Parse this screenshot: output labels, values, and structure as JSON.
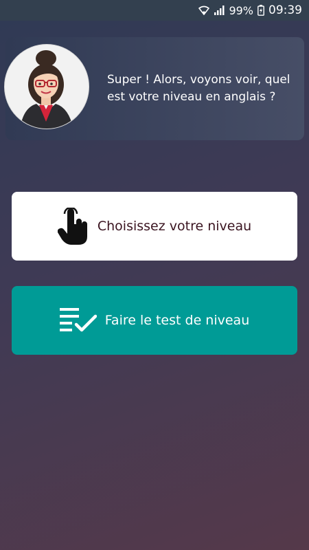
{
  "status_bar": {
    "battery": "99%",
    "time": "09:39",
    "icons": [
      "wifi-icon",
      "signal-icon",
      "battery-charging-icon"
    ]
  },
  "tutor": {
    "avatar_icon": "teacher-avatar",
    "message": "Super ! Alors, voyons voir, quel est votre niveau en anglais ?"
  },
  "actions": {
    "choose_level": {
      "label": "Choisissez votre niveau",
      "icon": "hand-pointer-icon"
    },
    "take_test": {
      "label": "Faire le test de niveau",
      "icon": "checklist-icon"
    }
  },
  "colors": {
    "status_bar": "#33404f",
    "primary_teal": "#009b96",
    "choose_text": "#3a1420"
  }
}
